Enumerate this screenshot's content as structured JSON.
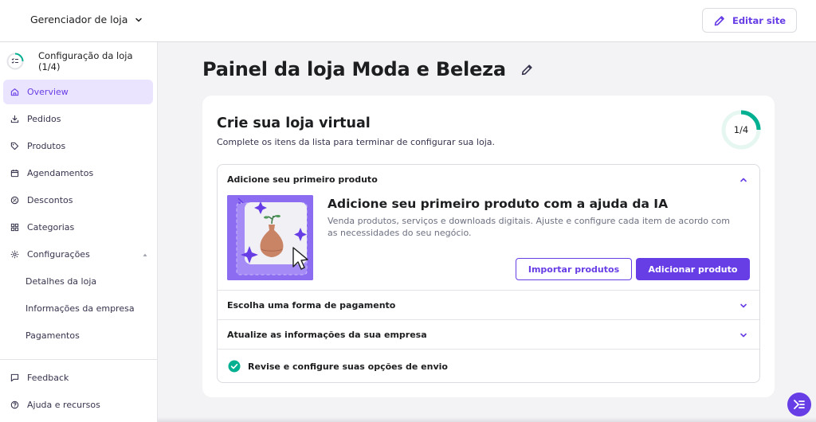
{
  "header": {
    "store_manager_label": "Gerenciador de loja",
    "edit_site_label": "Editar site"
  },
  "sidebar": {
    "setup_label": "Configuração da loja (1/4)",
    "items": [
      {
        "label": "Overview",
        "icon": "home-icon",
        "active": true
      },
      {
        "label": "Pedidos",
        "icon": "download-icon"
      },
      {
        "label": "Produtos",
        "icon": "tag-icon"
      },
      {
        "label": "Agendamentos",
        "icon": "calendar-icon"
      },
      {
        "label": "Descontos",
        "icon": "discount-icon"
      },
      {
        "label": "Categorias",
        "icon": "grid-icon"
      },
      {
        "label": "Configurações",
        "icon": "gear-icon",
        "expanded": true
      }
    ],
    "sub_items": [
      "Detalhes da loja",
      "Informações da empresa",
      "Pagamentos"
    ],
    "bottom_items": [
      {
        "label": "Feedback",
        "icon": "chat-icon"
      },
      {
        "label": "Ajuda e recursos",
        "icon": "help-icon"
      }
    ]
  },
  "main": {
    "page_title": "Painel da loja Moda e Beleza",
    "card": {
      "title": "Crie sua loja virtual",
      "subtitle": "Complete os itens da lista para terminar de configurar sua loja.",
      "progress_text": "1/4",
      "progress_fraction": 0.25,
      "steps": [
        {
          "label": "Adicione seu primeiro produto",
          "expanded": true
        },
        {
          "label": "Escolha uma forma de pagamento"
        },
        {
          "label": "Atualize as informações da sua empresa"
        },
        {
          "label": "Revise e configure suas opções de envio",
          "done": true
        }
      ],
      "expanded_step": {
        "title": "Adicione seu primeiro produto com a ajuda da IA",
        "description": "Venda produtos, serviços e downloads digitais. Ajuste e configure cada item de acordo com as necessidades do seu negócio.",
        "import_label": "Importar produtos",
        "add_label": "Adicionar produto"
      }
    }
  },
  "colors": {
    "accent": "#673de6",
    "accent_light": "#ebe4ff",
    "success": "#00b090",
    "background": "#f3f3f6"
  }
}
